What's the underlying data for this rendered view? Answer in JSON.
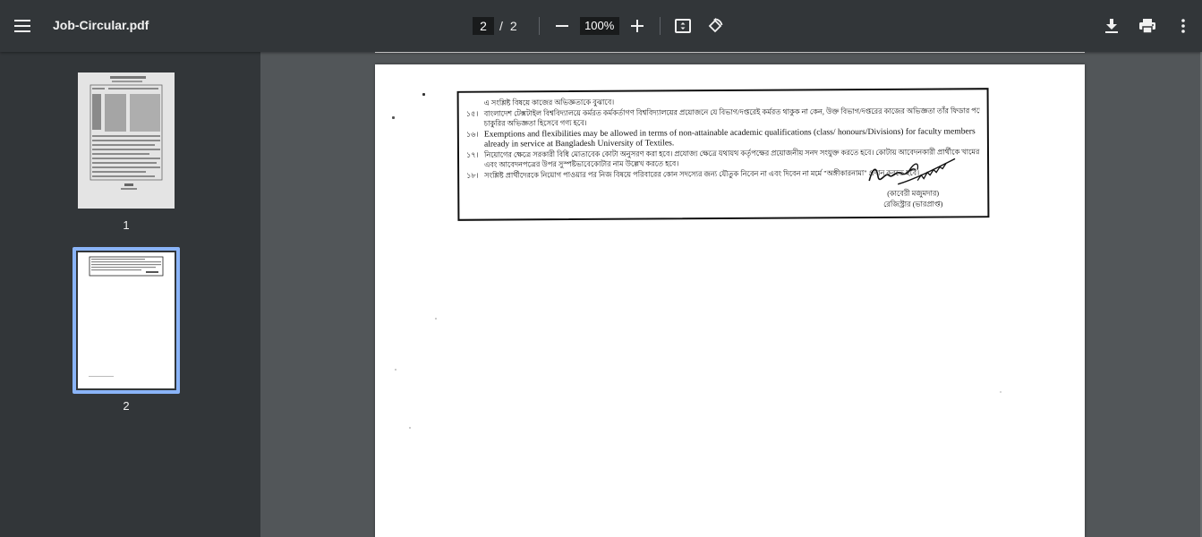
{
  "app": {
    "file_title": "Job-Circular.pdf"
  },
  "toolbar": {
    "current_page": "2",
    "page_separator": "/",
    "total_pages": "2",
    "zoom": "100%"
  },
  "icons": {
    "menu": "menu-icon",
    "zoom_out": "minus-icon",
    "zoom_in": "plus-icon",
    "fit": "fit-to-page-icon",
    "rotate": "rotate-icon",
    "download": "download-icon",
    "print": "print-icon",
    "more": "more-vert-icon"
  },
  "sidebar": {
    "thumbnails": [
      {
        "label": "1",
        "selected": false
      },
      {
        "label": "2",
        "selected": true
      }
    ]
  },
  "document": {
    "lines": [
      {
        "num": "",
        "text": "এ সংশ্লিষ্ট বিষয়ে কাজের অভিজ্ঞতাকে বুঝাবে।"
      },
      {
        "num": "১৫।",
        "text": "বাংলাদেশ টেক্সটাইল বিশ্ববিদ্যালয়ে কর্মরত কর্মকর্তাগণ বিশ্ববিদ্যালয়ের প্রয়োজনে যে বিভাগ/দপ্তরেই কর্মরত থাকুক না কেন, উক্ত বিভাগ/দপ্তরের কাজের অভিজ্ঞতা তাঁর ফিডার পদের"
      },
      {
        "num": "",
        "text": "চাকুরির অভিজ্ঞতা হিসেবে গণ্য হবে।"
      },
      {
        "num": "১৬।",
        "text": "Exemptions and flexibilities may be allowed in terms of non-attainable academic qualifications (class/ honours/Divisions) for faculty members already in service at Bangladesh University of Textiles.",
        "eng": true
      },
      {
        "num": "১৭।",
        "text": "নিয়োগের ক্ষেত্রে সরকারী বিধি মোতাবেক কোটা অনুসরণ করা হবে। প্রযোজ্য ক্ষেত্রে যথাযথ কর্তৃপক্ষের প্রয়োজনীয় সনদ সংযুক্ত করতে হবে। কোটায় আবেদনকারী প্রার্থীকে খামের উপর"
      },
      {
        "num": "",
        "text": "এবং আবেদনপত্রের উপর সুস্পষ্টভাবেকোটার নাম উল্লেখ করতে হবে।"
      },
      {
        "num": "১৮।",
        "text": "সংশ্লিষ্ট প্রার্থীদেরকে নিয়োগ পাওয়ার পর নিজ বিষয়ে পরিবারের কোন সদস্যের জন্য যৌতুক নিবেন না এবং দিবেন না মর্মে \"অঙ্গীকারনামা\" প্রদান করতে হবে।"
      }
    ],
    "signatory_name": "(কাবেরী মজুমদার)",
    "signatory_title": "রেজিস্ট্রার (ভারপ্রাপ্ত)"
  }
}
